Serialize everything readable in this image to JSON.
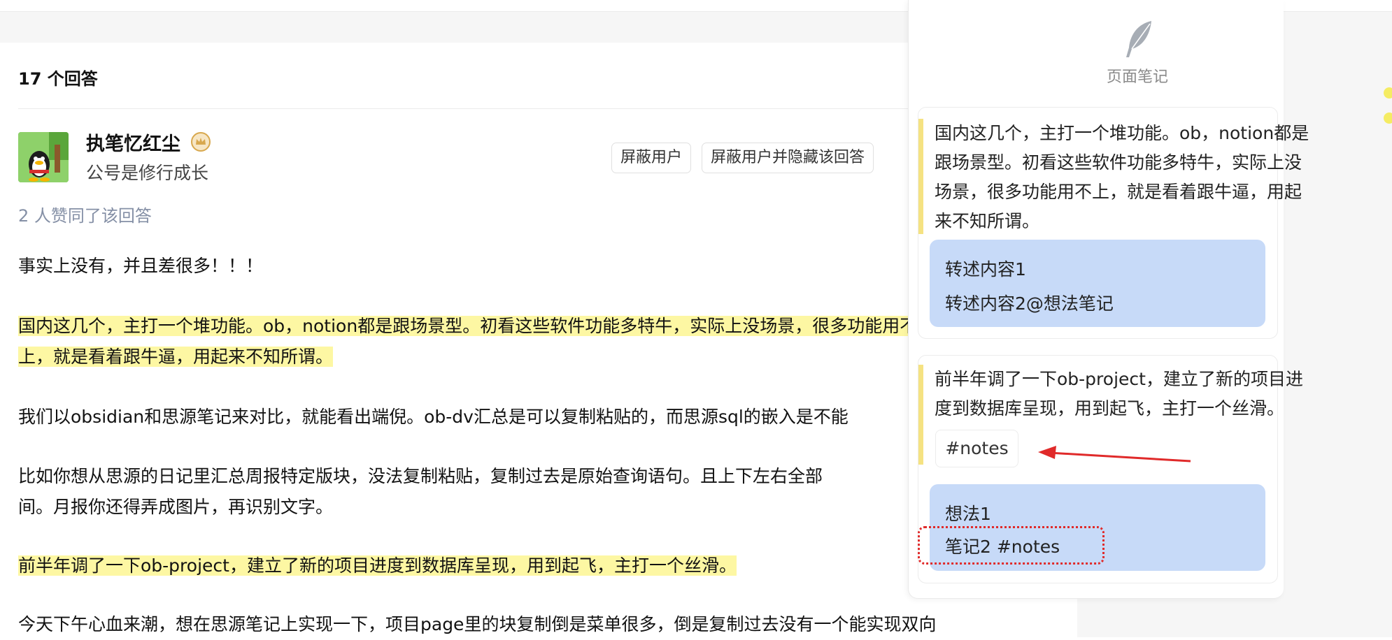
{
  "answers": {
    "count_title": "17 个回答"
  },
  "author": {
    "name": "执笔忆红尘",
    "bio": "公号是修行成长"
  },
  "actions": {
    "block_user": "屏蔽用户",
    "block_and_hide": "屏蔽用户并隐藏该回答"
  },
  "votes": "2 人赞同了该回答",
  "content": {
    "p1": "事实上没有，并且差很多！！！",
    "p2_line1": "国内这几个，主打一个堆功能。ob，notion都是跟场景型。初看这些软件功能多特牛，实际上没场景，很多功能用不",
    "p2_line2": "上，就是看着跟牛逼，用起来不知所谓。",
    "p3": "我们以obsidian和思源笔记来对比，就能看出端倪。ob-dv汇总是可以复制粘贴的，而思源sql的嵌入是不能",
    "p4_line1": "比如你想从思源的日记里汇总周报特定版块，没法复制粘贴，复制过去是原始查询语句。且上下左右全部",
    "p4_line2": "间。月报你还得弄成图片，再识别文字。",
    "p5": "前半年调了一下ob-project，建立了新的项目进度到数据库呈现，用到起飞，主打一个丝滑。",
    "p6": "今天下午心血来潮，想在思源笔记上实现一下，项目page里的块复制倒是菜单很多，倒是复制过去没有一个能实现双向"
  },
  "notes_panel": {
    "title": "页面笔记",
    "note1": {
      "quote_lines": [
        "国内这几个，主打一个堆功能。ob，notion都是",
        "跟场景型。初看这些软件功能多特牛，实际上没",
        "场景，很多功能用不上，就是看着跟牛逼，用起",
        "来不知所谓。"
      ],
      "comment_lines": [
        "转述内容1",
        "转述内容2@想法笔记"
      ]
    },
    "note2": {
      "quote_lines": [
        "前半年调了一下ob-project，建立了新的项目进",
        "度到数据库呈现，用到起飞，主打一个丝滑。"
      ],
      "tag": "#notes",
      "comment_lines": [
        "想法1",
        "笔记2 #notes"
      ]
    }
  },
  "colors": {
    "highlight": "#fdf7a3",
    "quote_bar": "#f5e282",
    "comment_bg": "#c7daf8",
    "annotation_red": "#e02a2a"
  }
}
